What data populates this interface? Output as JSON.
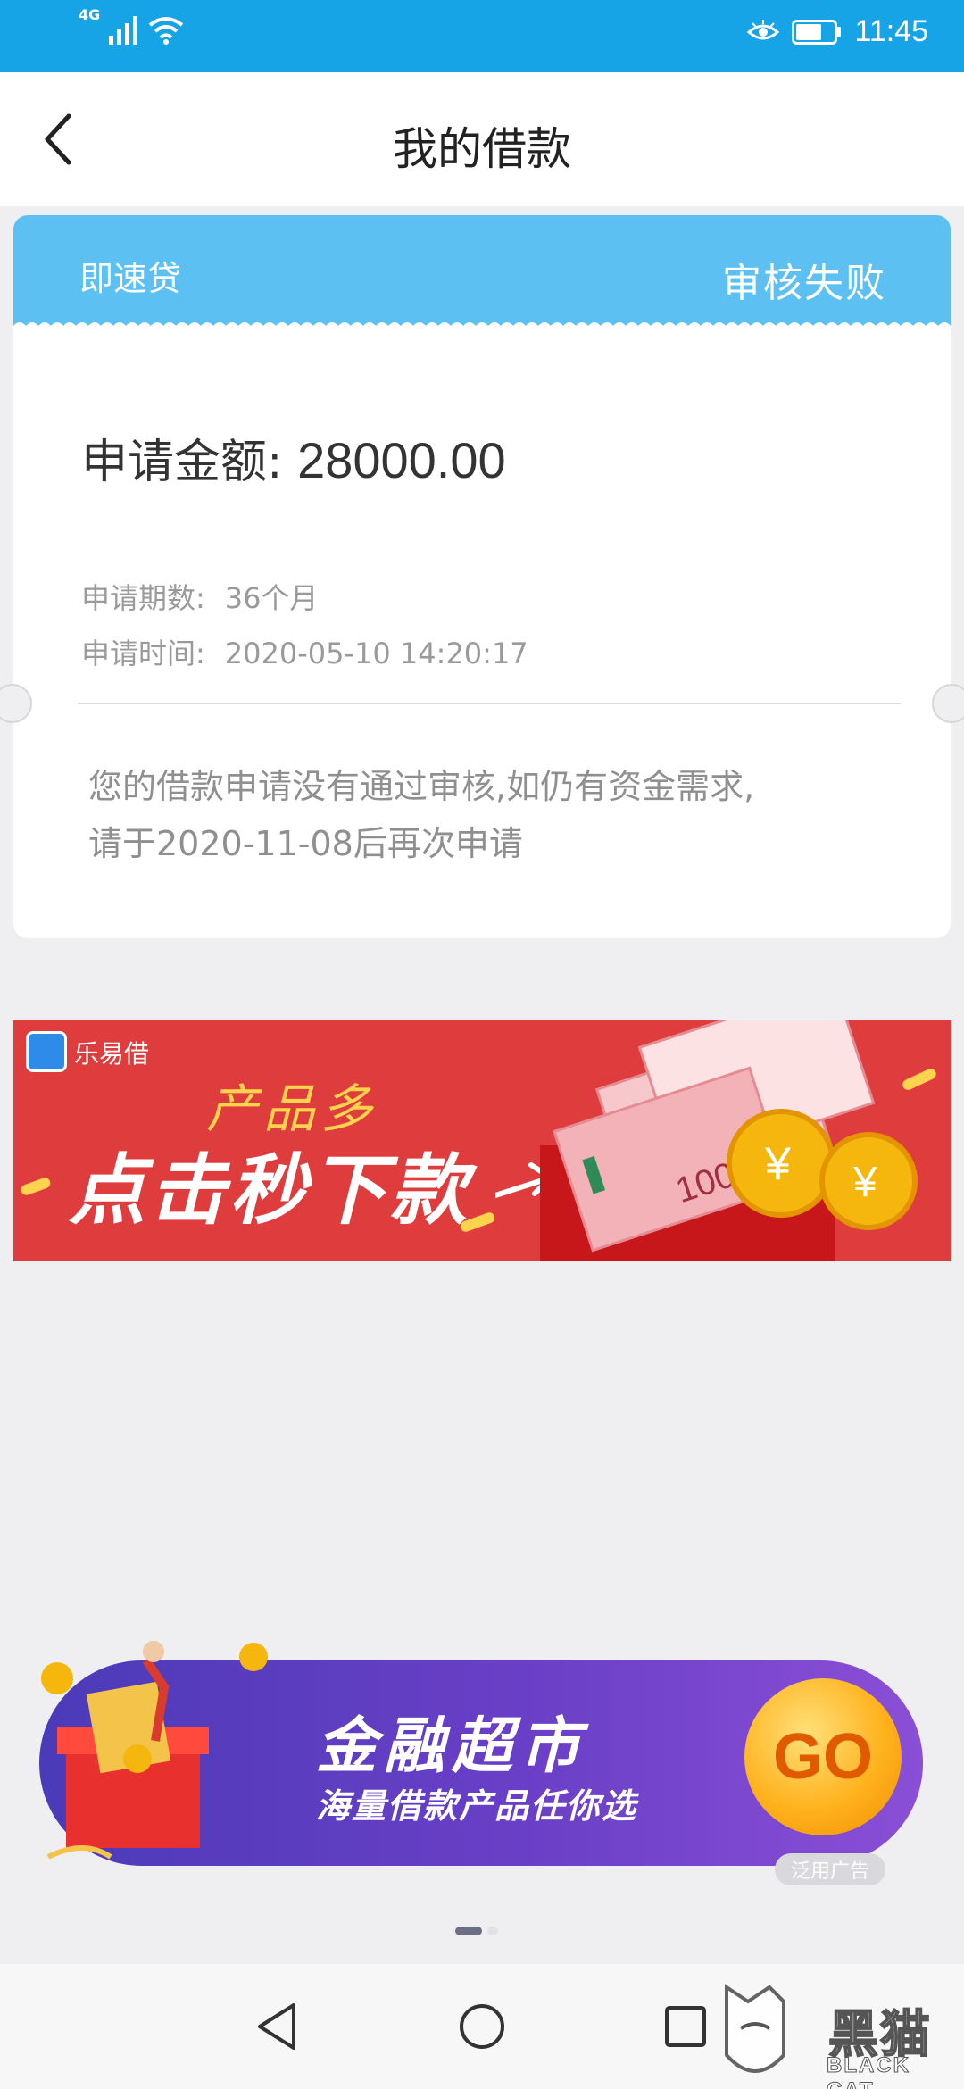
{
  "status_bar": {
    "network": "4G",
    "time": "11:45",
    "icons": [
      "signal-icon",
      "wifi-icon",
      "eye-comfort-icon",
      "battery-icon"
    ]
  },
  "header": {
    "title": "我的借款",
    "back_icon": "chevron-left-icon"
  },
  "loan_card": {
    "product_name": "即速贷",
    "status": "审核失败",
    "amount_label": "申请金额:",
    "amount_value": "28000.00",
    "term_label": "申请期数:",
    "term_value": "36个月",
    "time_label": "申请时间:",
    "time_value": "2020-05-10 14:20:17",
    "notice_line1": "您的借款申请没有通过审核,如仍有资金需求,",
    "notice_line2": "请于2020-11-08后再次申请",
    "header_color": "#5dc0f2"
  },
  "banner_ad": {
    "brand": "乐易借",
    "line1": "产品多",
    "line2": "点击秒下款",
    "note_value": "100",
    "coin_symbol": "¥",
    "bg_color": "#df3c3d"
  },
  "finance_banner": {
    "title": "金融超市",
    "subtitle": "海量借款产品任你选",
    "go_label": "GO",
    "ad_tag": "泛用广告"
  },
  "carousel": {
    "page": 1,
    "pages": 2
  },
  "nav_bar": {
    "buttons": [
      "back-triangle-icon",
      "home-circle-icon",
      "recents-square-icon"
    ]
  },
  "watermark": {
    "text": "黑猫",
    "sub": "BLACK CAT"
  }
}
